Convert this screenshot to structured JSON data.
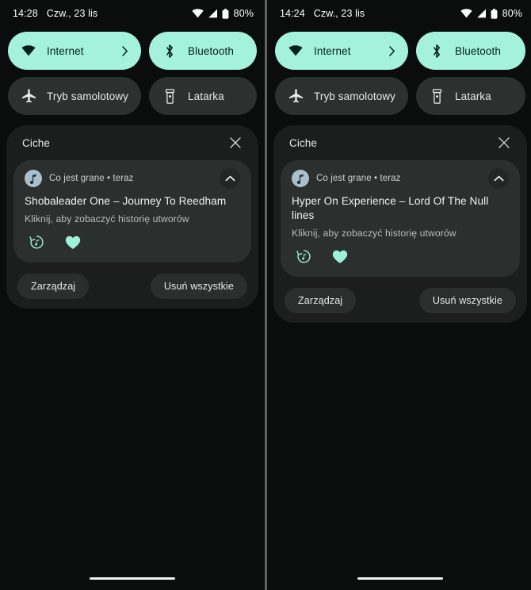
{
  "panels": [
    {
      "id": "left",
      "status_bar": {
        "time": "14:28",
        "date": "Czw., 23 lis",
        "battery_percent": "80%",
        "icons": [
          "wifi-icon",
          "signal-icon",
          "battery-icon"
        ]
      },
      "quick_settings": {
        "tiles": [
          {
            "label": "Internet",
            "icon": "wifi-icon",
            "state": "on",
            "has_chevron": true
          },
          {
            "label": "Bluetooth",
            "icon": "bluetooth-icon",
            "state": "on",
            "has_chevron": false
          },
          {
            "label": "Tryb samolotowy",
            "icon": "airplane-icon",
            "state": "off",
            "has_chevron": false
          },
          {
            "label": "Latarka",
            "icon": "flashlight-icon",
            "state": "off",
            "has_chevron": false
          }
        ]
      },
      "shade": {
        "section_title": "Ciche",
        "close_icon": "close-icon",
        "notification": {
          "app_icon": "music-note-icon",
          "source": "Co jest grane • teraz",
          "expand_icon": "chevron-up-icon",
          "title": "Shobaleader One – Journey To Reedham",
          "subtitle": "Kliknij, aby zobaczyć historię utworów",
          "actions": [
            {
              "icon": "song-history-icon"
            },
            {
              "icon": "heart-icon"
            }
          ]
        },
        "manage_label": "Zarządzaj",
        "clear_all_label": "Usuń wszystkie"
      }
    },
    {
      "id": "right",
      "status_bar": {
        "time": "14:24",
        "date": "Czw., 23 lis",
        "battery_percent": "80%",
        "icons": [
          "wifi-icon",
          "signal-icon",
          "battery-icon"
        ]
      },
      "quick_settings": {
        "tiles": [
          {
            "label": "Internet",
            "icon": "wifi-icon",
            "state": "on",
            "has_chevron": true
          },
          {
            "label": "Bluetooth",
            "icon": "bluetooth-icon",
            "state": "on",
            "has_chevron": false
          },
          {
            "label": "Tryb samolotowy",
            "icon": "airplane-icon",
            "state": "off",
            "has_chevron": false
          },
          {
            "label": "Latarka",
            "icon": "flashlight-icon",
            "state": "off",
            "has_chevron": false
          }
        ]
      },
      "shade": {
        "section_title": "Ciche",
        "close_icon": "close-icon",
        "notification": {
          "app_icon": "music-note-icon",
          "source": "Co jest grane • teraz",
          "expand_icon": "chevron-up-icon",
          "title": "Hyper On Experience – Lord Of The Null lines",
          "subtitle": "Kliknij, aby zobaczyć historię utworów",
          "actions": [
            {
              "icon": "song-history-icon"
            },
            {
              "icon": "heart-icon"
            }
          ]
        },
        "manage_label": "Zarządzaj",
        "clear_all_label": "Usuń wszystkie"
      }
    }
  ],
  "colors": {
    "accent_teal": "#a4f2dc",
    "tile_off": "#2c302f",
    "shade_bg": "#1b1e1d",
    "notification_bg": "#2b2f2e",
    "screen_bg": "#0b0d0c",
    "divider": "#5d6160"
  }
}
